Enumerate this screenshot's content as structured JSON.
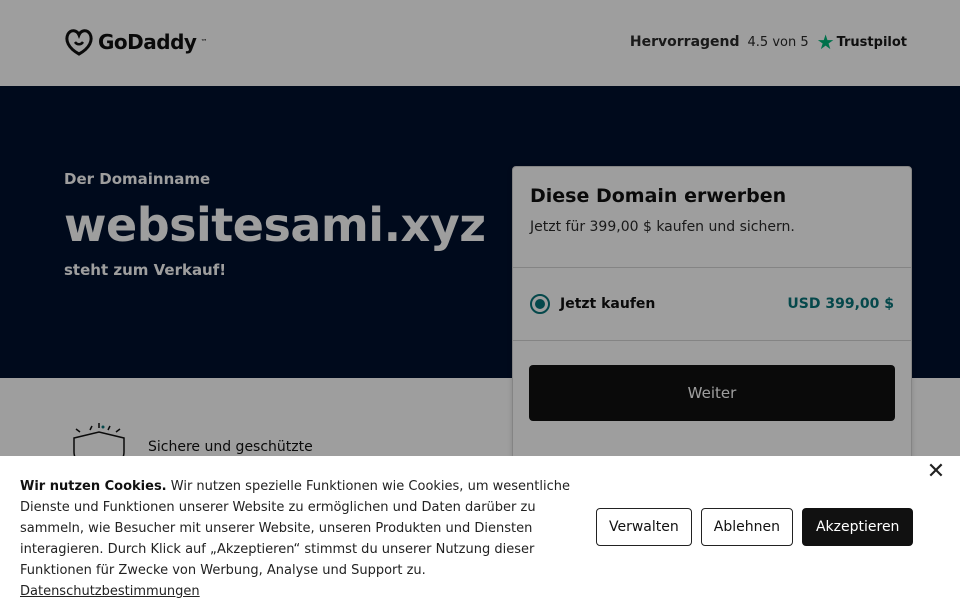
{
  "header": {
    "logo_text": "GoDaddy",
    "rating_label": "Hervorragend",
    "rating_score": "4.5 von 5",
    "trustpilot": "Trustpilot"
  },
  "hero": {
    "eyebrow": "Der Domainname",
    "domain": "websitesami.xyz",
    "subtitle": "steht zum Verkauf!"
  },
  "card": {
    "title": "Diese Domain erwerben",
    "description": "Jetzt für 399,00 $ kaufen und sichern.",
    "option_label": "Jetzt kaufen",
    "option_price": "USD 399,00 $",
    "button_label": "Weiter"
  },
  "feature": {
    "text": "Sichere und geschützte"
  },
  "cookie": {
    "heading": "Wir nutzen Cookies.",
    "body": " Wir nutzen spezielle Funktionen wie Cookies, um wesentliche Dienste und Funktionen unserer Website zu ermöglichen und Daten darüber zu sammeln, wie Besucher mit unserer Website, unseren Produkten und Diensten interagieren. Durch Klick auf „Akzeptieren“ stimmst du unserer Nutzung dieser Funktionen für Zwecke von Werbung, Analyse und Support zu. ",
    "link": "Datenschutzbestimmungen",
    "manage": "Verwalten",
    "reject": "Ablehnen",
    "accept": "Akzeptieren",
    "close": "✕"
  },
  "colors": {
    "hero_bg": "#00112e",
    "accent_teal": "#09757a",
    "trustpilot_green": "#00b67a"
  },
  "icons": [
    "godaddy-logo-icon",
    "trustpilot-star-icon",
    "radio-selected-icon",
    "shield-icon",
    "close-icon"
  ]
}
